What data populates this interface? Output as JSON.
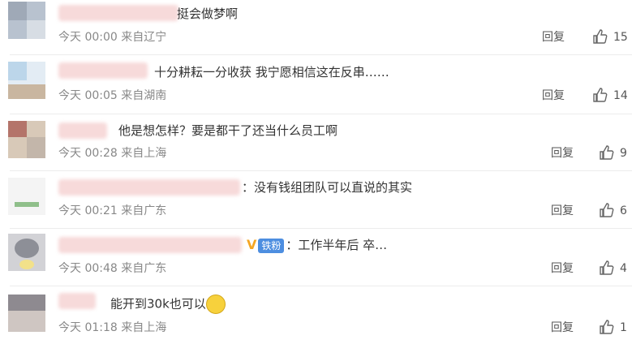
{
  "comments": [
    {
      "text": "挺会做梦啊",
      "meta": "今天 00:00 来自辽宁",
      "reply": "回复",
      "likes": "15"
    },
    {
      "text": "十分耕耘一分收获 我宁愿相信这在反串……",
      "meta": "今天 00:05 来自湖南",
      "reply": "回复",
      "likes": "14"
    },
    {
      "text": "他是想怎样？要是都干了还当什么员工啊",
      "meta": "今天 00:28 来自上海",
      "reply": "回复",
      "likes": "9"
    },
    {
      "text": "：没有钱组团队可以直说的其实",
      "meta": "今天 00:21 来自广东",
      "reply": "回复",
      "likes": "6"
    },
    {
      "text": "：工作半年后 卒…",
      "fan_badge": "铁粉",
      "meta": "今天 00:48 来自广东",
      "reply": "回复",
      "likes": "4"
    },
    {
      "text": "能开到30k也可以",
      "meta": "今天 01:18 来自上海",
      "reply": "回复",
      "likes": "1"
    }
  ],
  "icons": {
    "like": "thumbs-up-icon",
    "verified": "v-badge-icon",
    "emoji": "smiling-emoji-icon"
  },
  "colors": {
    "meta": "#888888",
    "fan_badge": "#4d8ee0",
    "verified": "#f5a623"
  }
}
